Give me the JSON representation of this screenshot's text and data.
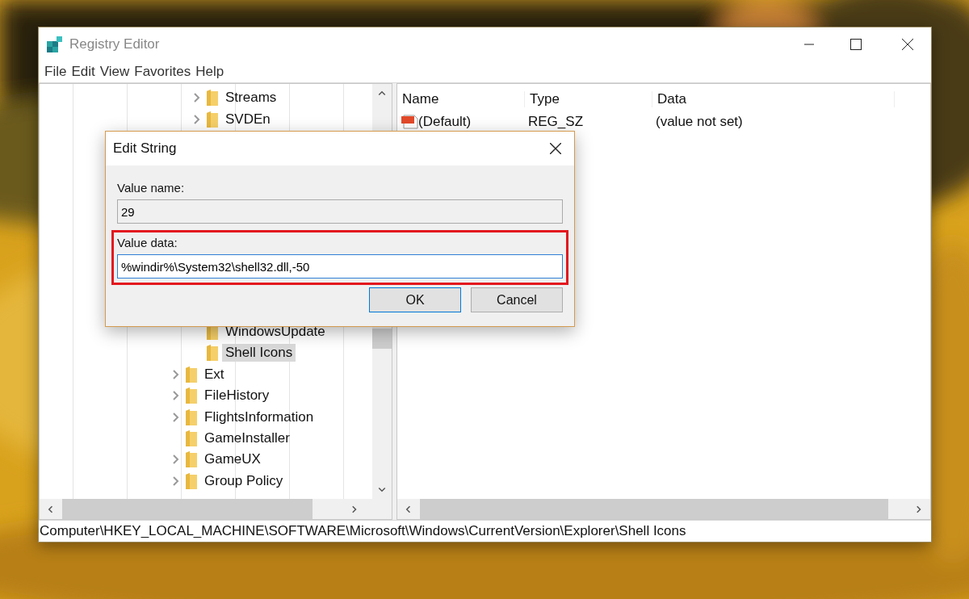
{
  "window": {
    "title": "Registry Editor"
  },
  "menu": [
    "File",
    "Edit",
    "View",
    "Favorites",
    "Help"
  ],
  "tree": {
    "nested_top": [
      {
        "label": "Streams",
        "expandable": true,
        "selected": false
      },
      {
        "label": "SVDEn",
        "expandable": true,
        "selected": false
      }
    ],
    "nested_bottom": [
      {
        "label": "WindowsUpdate",
        "expandable": false,
        "selected": false
      },
      {
        "label": "Shell Icons",
        "expandable": false,
        "selected": true
      }
    ],
    "siblings": [
      {
        "label": "Ext",
        "expandable": true,
        "selected": false
      },
      {
        "label": "FileHistory",
        "expandable": true,
        "selected": false
      },
      {
        "label": "FlightsInformation",
        "expandable": true,
        "selected": false
      },
      {
        "label": "GameInstaller",
        "expandable": false,
        "selected": false
      },
      {
        "label": "GameUX",
        "expandable": true,
        "selected": false
      },
      {
        "label": "Group Policy",
        "expandable": true,
        "selected": false
      }
    ]
  },
  "values": {
    "columns": [
      "Name",
      "Type",
      "Data"
    ],
    "rows": [
      {
        "name": "(Default)",
        "type": "REG_SZ",
        "data": "(value not set)"
      }
    ]
  },
  "status_bar": "Computer\\HKEY_LOCAL_MACHINE\\SOFTWARE\\Microsoft\\Windows\\CurrentVersion\\Explorer\\Shell Icons",
  "dialog": {
    "title": "Edit String",
    "value_name_label": "Value name:",
    "value_name": "29",
    "value_data_label": "Value data:",
    "value_data": "%windir%\\System32\\shell32.dll,-50",
    "highlighted": true,
    "buttons": [
      {
        "label": "OK",
        "default": true
      },
      {
        "label": "Cancel",
        "default": false
      }
    ]
  }
}
